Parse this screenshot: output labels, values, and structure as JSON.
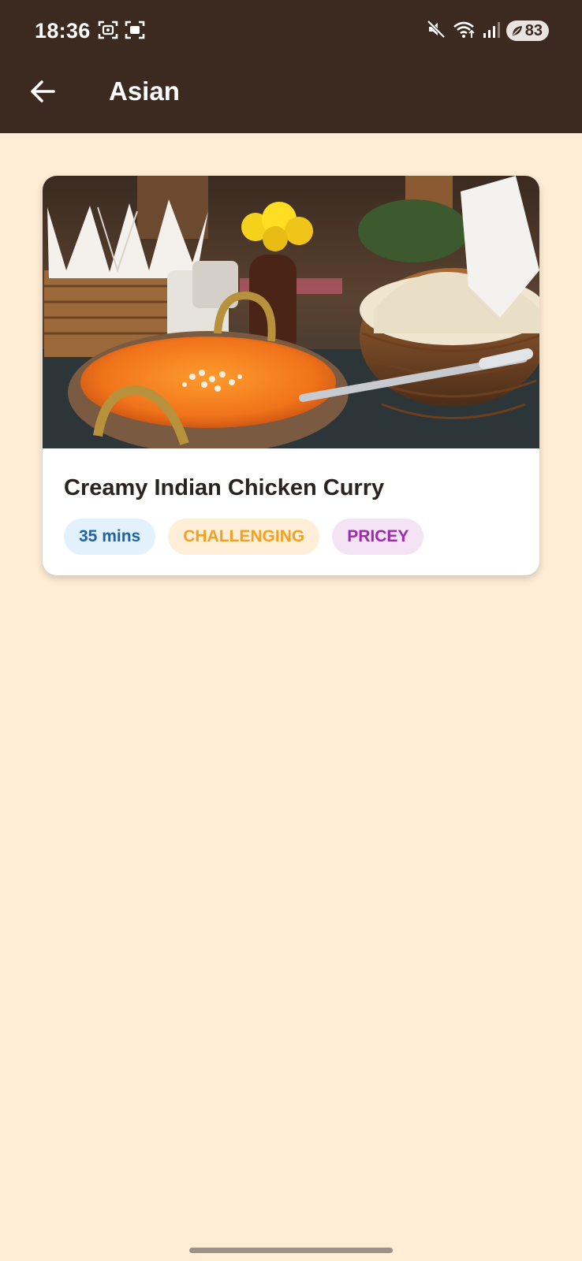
{
  "status_bar": {
    "time": "18:36",
    "battery": "83",
    "icons": [
      "screenshot-icon",
      "scan-icon",
      "mute-icon",
      "wifi-icon",
      "signal-icon",
      "battery-icon"
    ]
  },
  "header": {
    "title": "Asian",
    "back_icon": "arrow-left-icon"
  },
  "recipe": {
    "title": "Creamy Indian Chicken Curry",
    "tags": {
      "duration": "35 mins",
      "difficulty": "CHALLENGING",
      "price": "PRICEY"
    },
    "tag_colors": {
      "duration_bg": "#E3F1FC",
      "duration_text": "#1E63A8",
      "difficulty_bg": "#FFEFD9",
      "difficulty_text": "#F3A024",
      "price_bg": "#F3E3F4",
      "price_text": "#9C2CAA"
    }
  },
  "colors": {
    "app_bar": "#3C2A21",
    "background": "#FFEDD6",
    "card": "#FFFFFF"
  }
}
